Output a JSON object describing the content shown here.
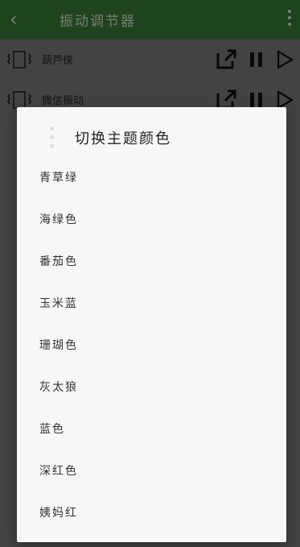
{
  "appbar": {
    "back_icon": "chevron-left-icon",
    "title": "振动调节器",
    "more_icon": "more-vertical-icon",
    "color": "#3a7a33"
  },
  "list": [
    {
      "name": "葫芦侠"
    },
    {
      "name": "微信振动"
    }
  ],
  "dialog": {
    "title": "切换主题颜色",
    "options": [
      "青草绿",
      "海绿色",
      "番茄色",
      "玉米蓝",
      "珊瑚色",
      "灰太狼",
      "蓝色",
      "深红色",
      "姨妈红"
    ]
  }
}
